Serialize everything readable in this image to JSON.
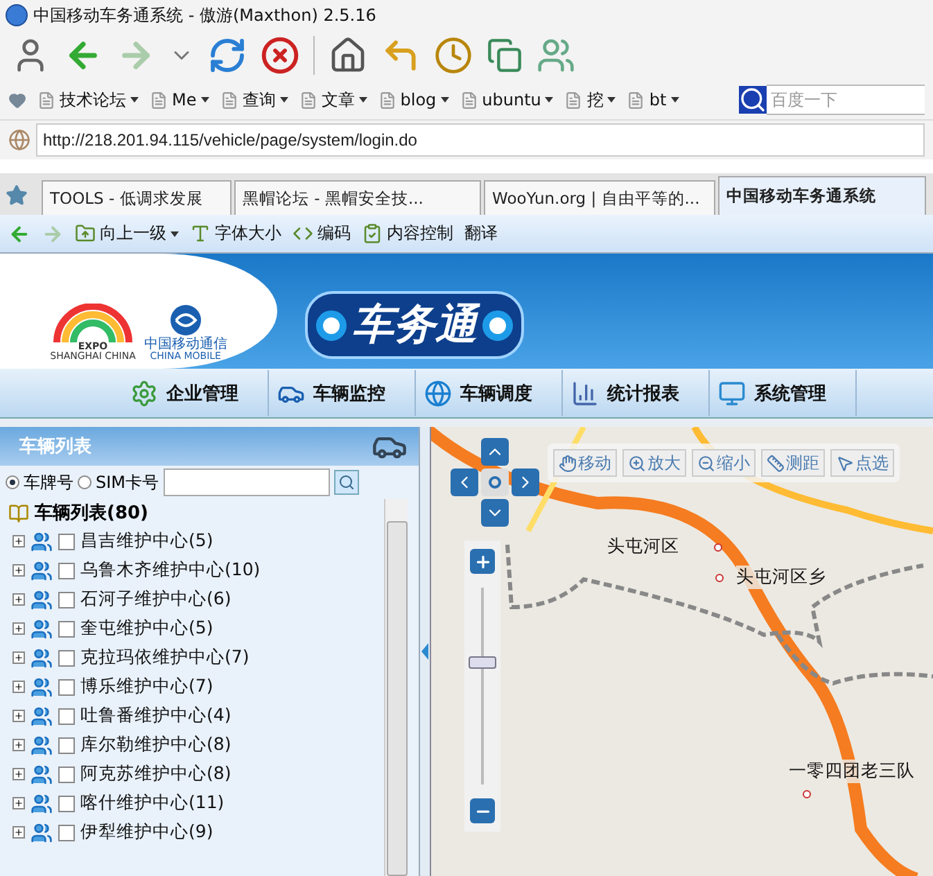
{
  "window": {
    "title": "中国移动车务通系统 - 傲游(Maxthon) 2.5.16"
  },
  "bookmarks": [
    "技术论坛",
    "Me",
    "查询",
    "文章",
    "blog",
    "ubuntu",
    "挖",
    "bt"
  ],
  "search": {
    "placeholder": "百度一下"
  },
  "address": {
    "value": "http://218.201.94.115/vehicle/page/system/login.do"
  },
  "tabs": [
    {
      "label": "TOOLS - 低调求发展",
      "selected": false
    },
    {
      "label": "黑帽论坛 - 黑帽安全技...",
      "selected": false
    },
    {
      "label": "WooYun.org | 自由平等的...",
      "selected": false
    },
    {
      "label": "中国移动车务通系统",
      "selected": true
    }
  ],
  "page_toolbar": [
    "向上一级",
    "字体大小",
    "编码",
    "内容控制",
    "翻译"
  ],
  "banner": {
    "expo_text": "EXPO",
    "expo_city": "SHANGHAI CHINA",
    "mobile_cn": "中国移动通信",
    "mobile_en": "CHINA MOBILE",
    "product_name": "车务通"
  },
  "nav": [
    "企业管理",
    "车辆监控",
    "车辆调度",
    "统计报表",
    "系统管理"
  ],
  "vehicle_panel": {
    "title": "车辆列表",
    "search_modes": [
      {
        "label": "车牌号",
        "selected": true
      },
      {
        "label": "SIM卡号",
        "selected": false
      }
    ],
    "tree_root": "车辆列表(80)",
    "groups": [
      {
        "label": "昌吉维护中心(5)",
        "checked": false,
        "expanded": false
      },
      {
        "label": "乌鲁木齐维护中心(10)",
        "checked": false,
        "expanded": false
      },
      {
        "label": "石河子维护中心(6)",
        "checked": false,
        "expanded": false
      },
      {
        "label": "奎屯维护中心(5)",
        "checked": false,
        "expanded": false
      },
      {
        "label": "克拉玛依维护中心(7)",
        "checked": false,
        "expanded": false
      },
      {
        "label": "博乐维护中心(7)",
        "checked": false,
        "expanded": false
      },
      {
        "label": "吐鲁番维护中心(4)",
        "checked": false,
        "expanded": false
      },
      {
        "label": "库尔勒维护中心(8)",
        "checked": false,
        "expanded": false
      },
      {
        "label": "阿克苏维护中心(8)",
        "checked": false,
        "expanded": false
      },
      {
        "label": "喀什维护中心(11)",
        "checked": false,
        "expanded": false
      },
      {
        "label": "伊犁维护中心(9)",
        "checked": false,
        "expanded": false
      }
    ]
  },
  "map": {
    "tools": [
      "移动",
      "放大",
      "缩小",
      "测距",
      "点选"
    ],
    "zoom": {
      "level": 0.62
    },
    "places": [
      "头屯河区",
      "头屯河区乡",
      "一零四团老三队"
    ]
  }
}
